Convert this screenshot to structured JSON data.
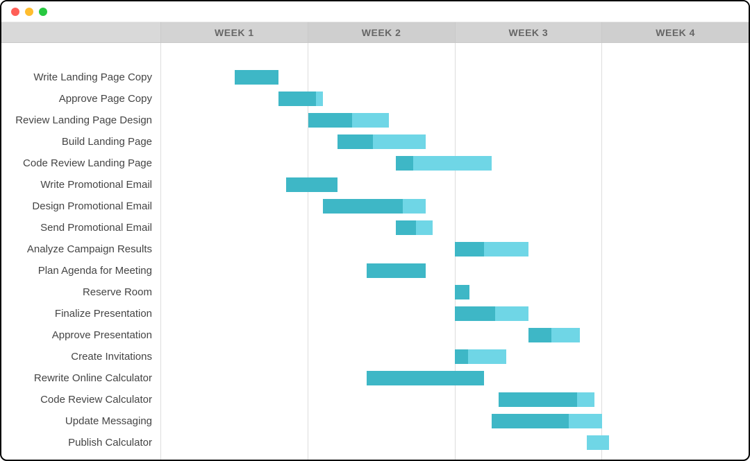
{
  "chart_data": {
    "type": "gantt",
    "title": "",
    "time_axis": {
      "unit": "week",
      "start": 0,
      "end": 4,
      "tick_labels": [
        "WEEK 1",
        "WEEK 2",
        "WEEK 3",
        "WEEK 4"
      ]
    },
    "tasks": [
      {
        "name": "Write Landing Page Copy",
        "start": 0.5,
        "end": 0.8,
        "progress": 1.0
      },
      {
        "name": "Approve Page Copy",
        "start": 0.8,
        "end": 1.1,
        "progress": 0.85
      },
      {
        "name": "Review Landing Page Design",
        "start": 1.0,
        "end": 1.55,
        "progress": 0.55
      },
      {
        "name": "Build Landing Page",
        "start": 1.2,
        "end": 1.8,
        "progress": 0.4
      },
      {
        "name": "Code Review Landing Page",
        "start": 1.6,
        "end": 2.25,
        "progress": 0.18
      },
      {
        "name": "Write Promotional Email",
        "start": 0.85,
        "end": 1.2,
        "progress": 1.0
      },
      {
        "name": "Design Promotional Email",
        "start": 1.1,
        "end": 1.8,
        "progress": 0.78
      },
      {
        "name": "Send Promotional Email",
        "start": 1.6,
        "end": 1.85,
        "progress": 0.55
      },
      {
        "name": "Analyze Campaign Results",
        "start": 2.0,
        "end": 2.5,
        "progress": 0.4
      },
      {
        "name": "Plan Agenda for Meeting",
        "start": 1.4,
        "end": 1.8,
        "progress": 1.0
      },
      {
        "name": "Reserve Room",
        "start": 2.0,
        "end": 2.1,
        "progress": 1.0
      },
      {
        "name": "Finalize Presentation",
        "start": 2.0,
        "end": 2.5,
        "progress": 0.55
      },
      {
        "name": "Approve Presentation",
        "start": 2.5,
        "end": 2.85,
        "progress": 0.45
      },
      {
        "name": "Create Invitations",
        "start": 2.0,
        "end": 2.35,
        "progress": 0.25
      },
      {
        "name": "Rewrite Online Calculator",
        "start": 1.4,
        "end": 2.2,
        "progress": 1.0
      },
      {
        "name": "Code Review Calculator",
        "start": 2.3,
        "end": 2.95,
        "progress": 0.82
      },
      {
        "name": "Update Messaging",
        "start": 2.25,
        "end": 3.0,
        "progress": 0.7
      },
      {
        "name": "Publish Calculator",
        "start": 2.9,
        "end": 3.05,
        "progress": 0.0
      }
    ]
  },
  "week_labels": [
    "WEEK 1",
    "WEEK 2",
    "WEEK 3",
    "WEEK 4"
  ],
  "colors": {
    "bar_light": "#6fd6e6",
    "bar_dark": "#3eb7c6",
    "header_bg": "#d3d3d3",
    "grid": "#dddddd"
  }
}
